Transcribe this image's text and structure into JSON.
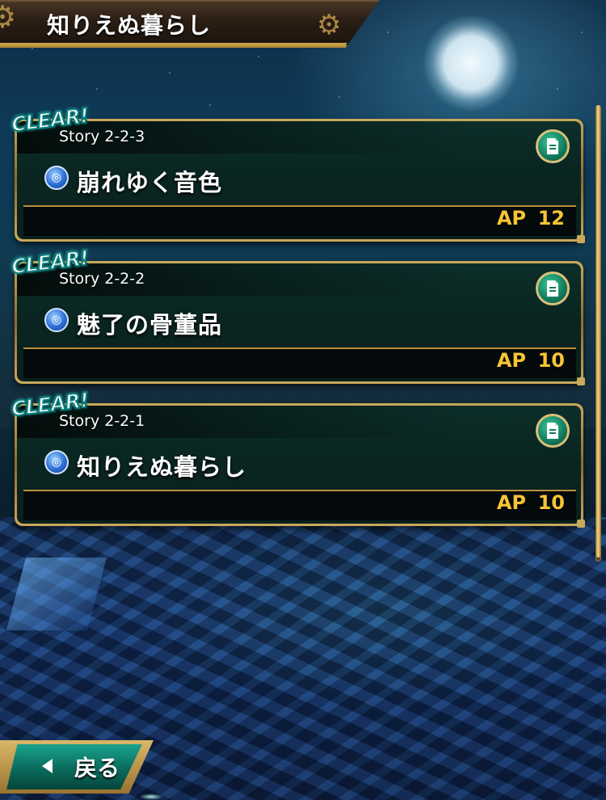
{
  "header": {
    "title": "知りえぬ暮らし"
  },
  "stories": [
    {
      "clear_label": "CLEAR!",
      "code": "Story 2-2-3",
      "attribute_icon": "water-drop-icon",
      "title": "崩れゆく音色",
      "ap_label": "AP",
      "ap_cost": "12",
      "detail_icon": "document-icon"
    },
    {
      "clear_label": "CLEAR!",
      "code": "Story 2-2-2",
      "attribute_icon": "water-drop-icon",
      "title": "魅了の骨董品",
      "ap_label": "AP",
      "ap_cost": "10",
      "detail_icon": "document-icon"
    },
    {
      "clear_label": "CLEAR!",
      "code": "Story 2-2-1",
      "attribute_icon": "water-drop-icon",
      "title": "知りえぬ暮らし",
      "ap_label": "AP",
      "ap_cost": "10",
      "detail_icon": "document-icon"
    }
  ],
  "footer": {
    "back_label": "戻る",
    "back_icon": "chevron-left-icon"
  },
  "colors": {
    "gold_frame": "#c9a95a",
    "ap_text": "#f7c436",
    "card_bg": "#0a2622",
    "clear_outline": "#0c7f7c",
    "back_button": "#0a6b5c"
  }
}
